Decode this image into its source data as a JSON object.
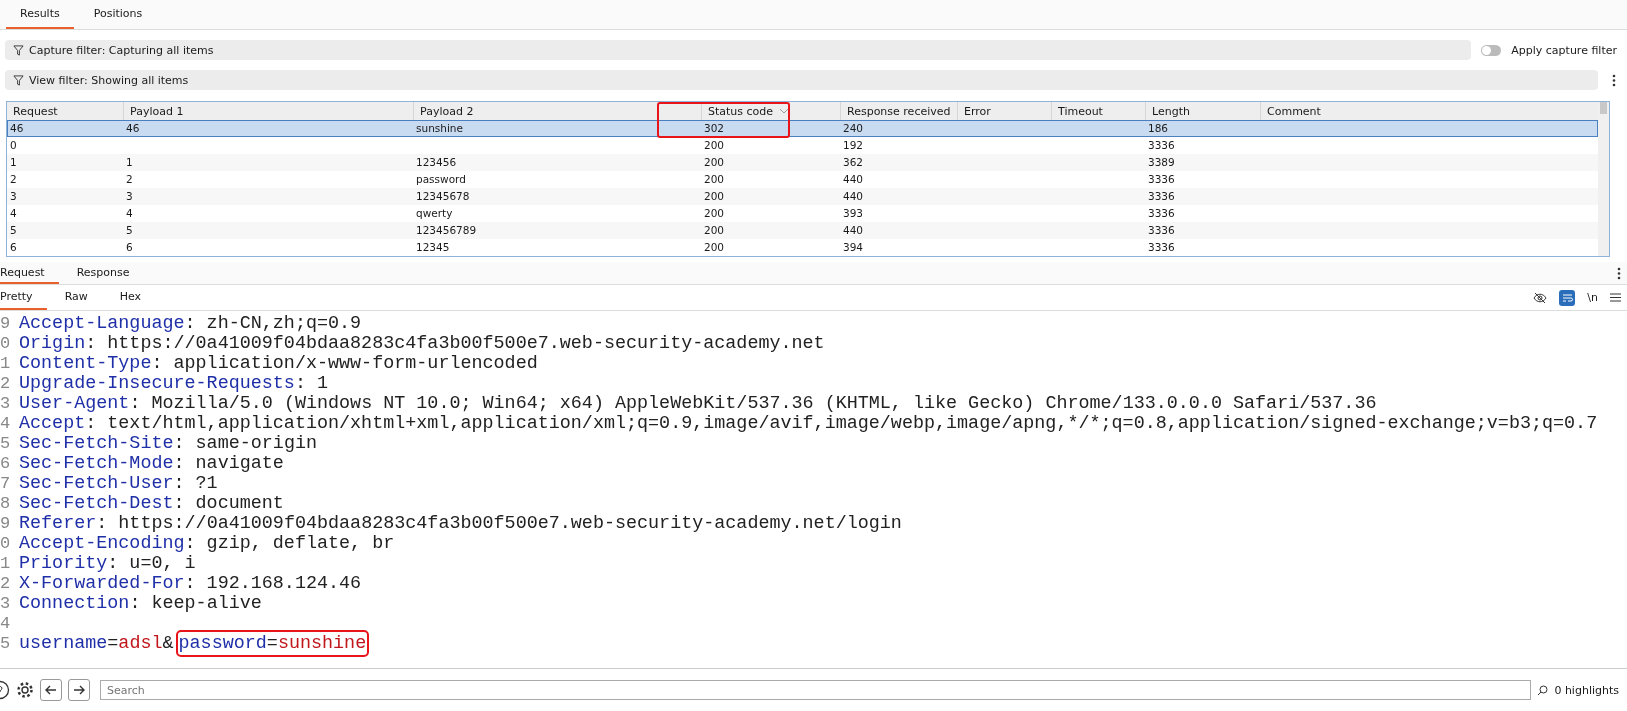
{
  "top_tabs": [
    {
      "label": "Results",
      "selected": true
    },
    {
      "label": "Positions",
      "selected": false
    }
  ],
  "capture_filter": {
    "label": "Capture filter: Capturing all items",
    "toggle_label": "Apply capture filter",
    "on": false
  },
  "view_filter": {
    "label": "View filter: Showing all items"
  },
  "table": {
    "columns": [
      {
        "label": "Request",
        "sorted": false
      },
      {
        "label": "Payload 1",
        "sorted": false
      },
      {
        "label": "Payload 2",
        "sorted": false
      },
      {
        "label": "Status code",
        "sorted": true,
        "highlighted": true
      },
      {
        "label": "Response received",
        "sorted": false
      },
      {
        "label": "Error",
        "sorted": false
      },
      {
        "label": "Timeout",
        "sorted": false
      },
      {
        "label": "Length",
        "sorted": false
      },
      {
        "label": "Comment",
        "sorted": false
      }
    ],
    "rows": [
      {
        "selected": true,
        "cells": [
          "46",
          "46",
          "sunshine",
          "302",
          "240",
          null,
          null,
          "186",
          null
        ]
      },
      {
        "selected": false,
        "cells": [
          "0",
          null,
          null,
          "200",
          "192",
          null,
          null,
          "3336",
          null
        ]
      },
      {
        "selected": false,
        "cells": [
          "1",
          "1",
          "123456",
          "200",
          "362",
          null,
          null,
          "3389",
          null
        ]
      },
      {
        "selected": false,
        "cells": [
          "2",
          "2",
          "password",
          "200",
          "440",
          null,
          null,
          "3336",
          null
        ]
      },
      {
        "selected": false,
        "cells": [
          "3",
          "3",
          "12345678",
          "200",
          "440",
          null,
          null,
          "3336",
          null
        ]
      },
      {
        "selected": false,
        "cells": [
          "4",
          "4",
          "qwerty",
          "200",
          "393",
          null,
          null,
          "3336",
          null
        ]
      },
      {
        "selected": false,
        "cells": [
          "5",
          "5",
          "123456789",
          "200",
          "440",
          null,
          null,
          "3336",
          null
        ]
      },
      {
        "selected": false,
        "cells": [
          "6",
          "6",
          "12345",
          "200",
          "394",
          null,
          null,
          "3336",
          null
        ]
      }
    ]
  },
  "message_tabs": [
    {
      "label": "Request",
      "selected": true
    },
    {
      "label": "Response",
      "selected": false
    }
  ],
  "view_tabs": [
    {
      "label": "Pretty",
      "selected": true
    },
    {
      "label": "Raw",
      "selected": false
    },
    {
      "label": "Hex",
      "selected": false
    }
  ],
  "editor_toolbar": {
    "wrap_on": true,
    "newline_label": "\\n"
  },
  "code_lines": [
    {
      "number": "9",
      "segments": [
        {
          "kind": "key",
          "text": "Accept-Language"
        },
        {
          "kind": "plain",
          "text": ": zh-CN,zh;q=0.9"
        }
      ]
    },
    {
      "number": "0",
      "segments": [
        {
          "kind": "key",
          "text": "Origin"
        },
        {
          "kind": "plain",
          "text": ": https://0a41009f04bdaa8283c4fa3b00f500e7.web-security-academy.net"
        }
      ]
    },
    {
      "number": "1",
      "segments": [
        {
          "kind": "key",
          "text": "Content-Type"
        },
        {
          "kind": "plain",
          "text": ": application/x-www-form-urlencoded"
        }
      ]
    },
    {
      "number": "2",
      "segments": [
        {
          "kind": "key",
          "text": "Upgrade-Insecure-Requests"
        },
        {
          "kind": "plain",
          "text": ": 1"
        }
      ]
    },
    {
      "number": "3",
      "segments": [
        {
          "kind": "key",
          "text": "User-Agent"
        },
        {
          "kind": "plain",
          "text": ": Mozilla/5.0 (Windows NT 10.0; Win64; x64) AppleWebKit/537.36 (KHTML, like Gecko) Chrome/133.0.0.0 Safari/537.36"
        }
      ]
    },
    {
      "number": "4",
      "segments": [
        {
          "kind": "key",
          "text": "Accept"
        },
        {
          "kind": "plain",
          "text": ": text/html,application/xhtml+xml,application/xml;q=0.9,image/avif,image/webp,image/apng,*/*;q=0.8,application/signed-exchange;v=b3;q=0.7"
        }
      ]
    },
    {
      "number": "5",
      "segments": [
        {
          "kind": "key",
          "text": "Sec-Fetch-Site"
        },
        {
          "kind": "plain",
          "text": ": same-origin"
        }
      ]
    },
    {
      "number": "6",
      "segments": [
        {
          "kind": "key",
          "text": "Sec-Fetch-Mode"
        },
        {
          "kind": "plain",
          "text": ": navigate"
        }
      ]
    },
    {
      "number": "7",
      "segments": [
        {
          "kind": "key",
          "text": "Sec-Fetch-User"
        },
        {
          "kind": "plain",
          "text": ": ?1"
        }
      ]
    },
    {
      "number": "8",
      "segments": [
        {
          "kind": "key",
          "text": "Sec-Fetch-Dest"
        },
        {
          "kind": "plain",
          "text": ": document"
        }
      ]
    },
    {
      "number": "9",
      "segments": [
        {
          "kind": "key",
          "text": "Referer"
        },
        {
          "kind": "plain",
          "text": ": https://0a41009f04bdaa8283c4fa3b00f500e7.web-security-academy.net/login"
        }
      ]
    },
    {
      "number": "0",
      "segments": [
        {
          "kind": "key",
          "text": "Accept-Encoding"
        },
        {
          "kind": "plain",
          "text": ": gzip, deflate, br"
        }
      ]
    },
    {
      "number": "1",
      "segments": [
        {
          "kind": "key",
          "text": "Priority"
        },
        {
          "kind": "plain",
          "text": ": u=0, i"
        }
      ]
    },
    {
      "number": "2",
      "segments": [
        {
          "kind": "key",
          "text": "X-Forwarded-For"
        },
        {
          "kind": "plain",
          "text": ": 192.168.124.46"
        }
      ]
    },
    {
      "number": "3",
      "segments": [
        {
          "kind": "key",
          "text": "Connection"
        },
        {
          "kind": "plain",
          "text": ": keep-alive"
        }
      ]
    },
    {
      "number": "4"
    },
    {
      "number": "5",
      "segments": [
        {
          "kind": "key",
          "text": "username"
        },
        {
          "kind": "plain",
          "text": "="
        },
        {
          "kind": "value",
          "text": "adsl"
        },
        {
          "kind": "plain",
          "text": "&"
        },
        {
          "kind": "group",
          "highlighted": true,
          "children": [
            {
              "kind": "key",
              "text": "password"
            },
            {
              "kind": "plain",
              "text": "="
            },
            {
              "kind": "value",
              "text": "sunshine"
            }
          ]
        }
      ]
    }
  ],
  "search": {
    "placeholder": "Search",
    "highlights": "0 highlights"
  }
}
